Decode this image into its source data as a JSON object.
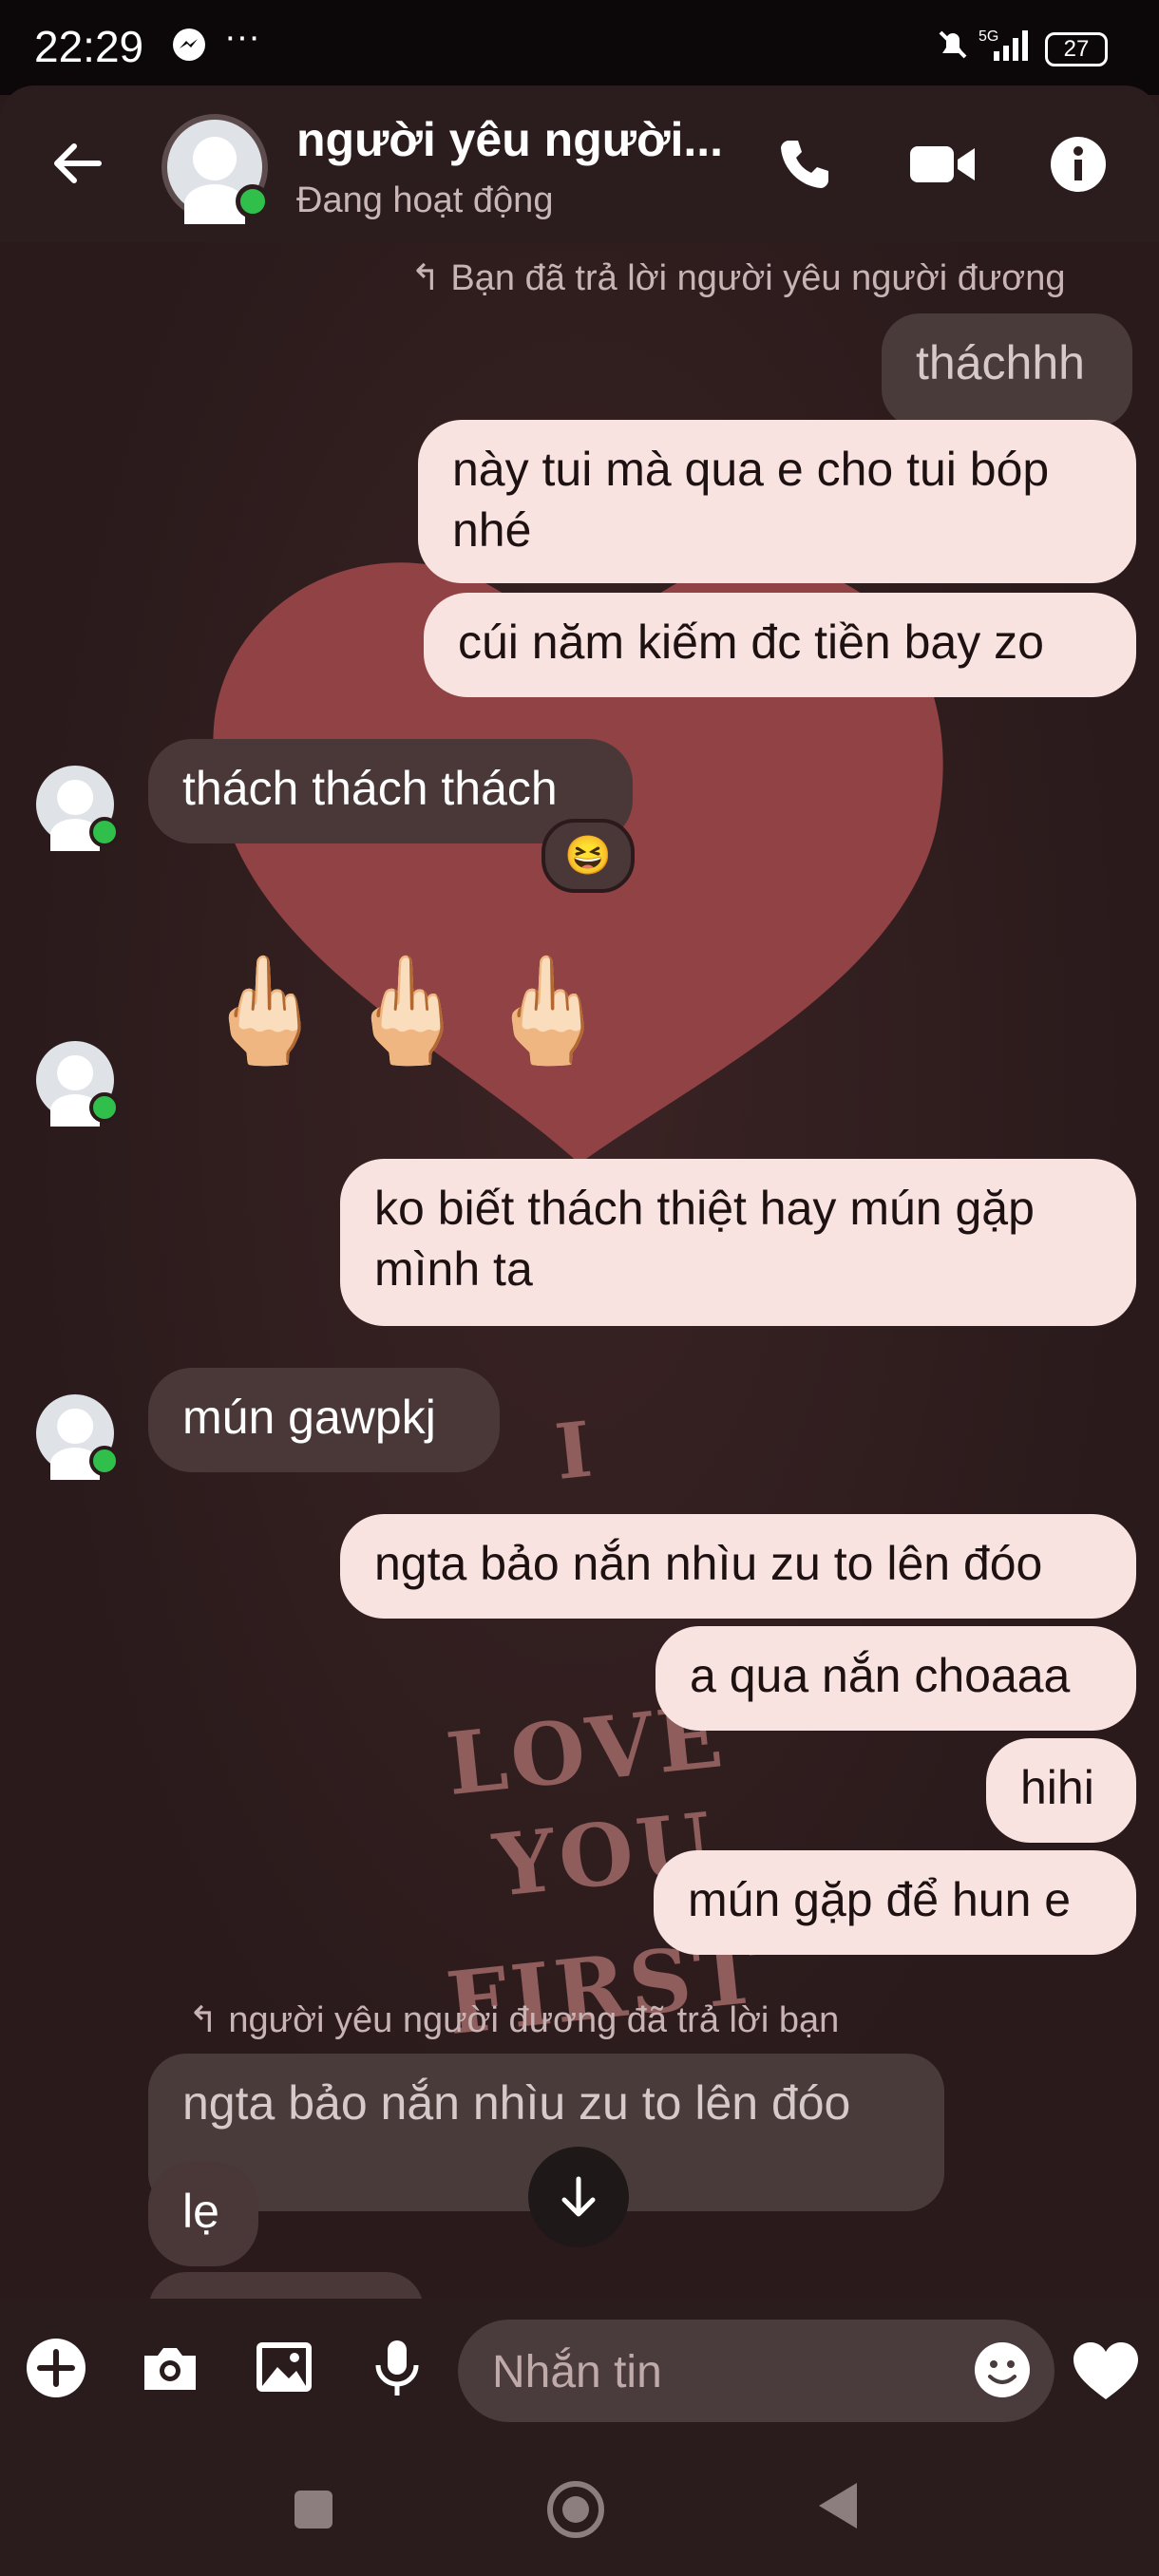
{
  "status_bar": {
    "time": "22:29",
    "messenger_icon": "messenger-icon",
    "dots": "···",
    "network": "5G",
    "battery": "27"
  },
  "header": {
    "name": "người yêu người...",
    "status": "Đang hoạt động"
  },
  "messages": {
    "reply_note_1": "↰ Bạn đã trả lời người yêu người đương",
    "quoted_1": "tháchhh",
    "out_1": "này tui mà qua e cho tui bóp nhé",
    "out_2": "cúi năm kiếm đc tiền bay zo",
    "in_1": "thách thách thách",
    "reaction_1": "😆",
    "in_2_fingers": [
      "🖕🏻",
      "🖕🏻",
      "🖕🏻"
    ],
    "out_3": "ko biết thách thiệt hay mún gặp mình ta",
    "in_3": "mún gawpkj",
    "out_4": "ngta bảo nắn nhìu zu to lên đóo",
    "out_5": "a qua nắn choaaa",
    "out_6": "hihi",
    "out_7": "mún gặp để hun e",
    "reply_note_2": "↰ người yêu người đương đã trả lời bạn",
    "quoted_2": "ngta bảo nắn nhìu zu to lên đóo",
    "in_4": "lẹ"
  },
  "background_text": [
    "I",
    "LOVE",
    "YOU",
    "FIRST"
  ],
  "composer": {
    "placeholder": "Nhắn tin"
  },
  "colors": {
    "outgoing_bubble": "#f9e3e0",
    "incoming_bubble": "#4a3838",
    "online_dot": "#2fbf4a",
    "background": "#2a1a1b"
  }
}
